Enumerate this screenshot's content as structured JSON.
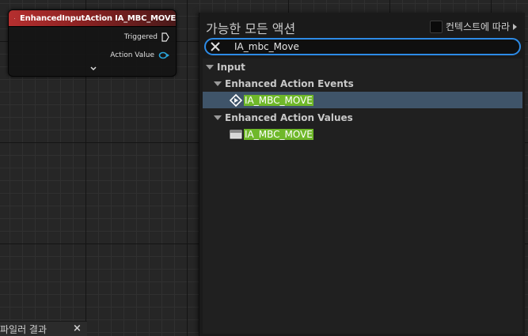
{
  "node": {
    "title": "EnhancedInputAction IA_MBC_MOVE",
    "pins": {
      "triggered": "Triggered",
      "action_value": "Action Value"
    },
    "expand_glyph": "⌄"
  },
  "bottom_tab": {
    "label": "파일러 결과",
    "close": "×"
  },
  "menu": {
    "title": "가능한 모든 액션",
    "context_label": "컨텍스트에 따라",
    "search": {
      "value": "IA_mbc_Move",
      "placeholder": ""
    },
    "tree": [
      {
        "label": "Input"
      },
      {
        "label": "Enhanced Action Events"
      },
      {
        "label": "IA_MBC_MOVE"
      },
      {
        "label": "Enhanced Action Values"
      },
      {
        "label": "IA_MBC_MOVE"
      }
    ]
  },
  "colors": {
    "node_header": "#b52f2f",
    "selection": "#3f5469",
    "search_border": "#2d8be6",
    "highlight": "#6fb82a"
  },
  "icons": {
    "node": "input-action-diamond-icon",
    "exec_pin": "exec-pin-icon",
    "value_pin": "value-pin-icon",
    "clear": "close-icon",
    "event_item": "event-diamond-icon",
    "value_item": "value-getter-icon"
  }
}
